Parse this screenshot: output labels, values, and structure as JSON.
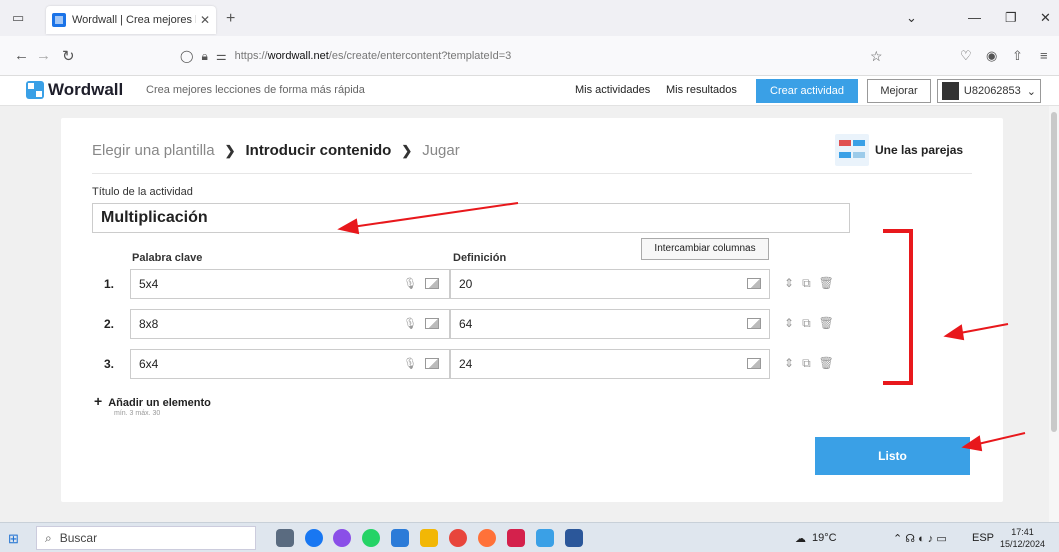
{
  "browser": {
    "tab_title": "Wordwall | Crea mejores leccion",
    "tab_close": "✕",
    "new_tab": "+",
    "url_host": "wordwall.net",
    "url_prefix": "https://",
    "url_path": "/es/create/entercontent?templateId=3"
  },
  "header": {
    "logo_text": "Wordwall",
    "tagline": "Crea mejores lecciones de forma más rápida",
    "mis_actividades": "Mis actividades",
    "mis_resultados": "Mis resultados",
    "crear_actividad": "Crear actividad",
    "mejorar": "Mejorar",
    "username": "U82062853"
  },
  "breadcrumb": {
    "step1": "Elegir una plantilla",
    "step2": "Introducir contenido",
    "step3": "Jugar"
  },
  "template": {
    "name": "Une las parejas"
  },
  "form": {
    "title_label": "Título de la actividad",
    "title_value": "Multiplicación",
    "swap_button": "Intercambiar columnas",
    "col_keyword": "Palabra clave",
    "col_definition": "Definición",
    "rows": [
      {
        "num": "1.",
        "keyword": "5x4",
        "definition": "20"
      },
      {
        "num": "2.",
        "keyword": "8x8",
        "definition": "64"
      },
      {
        "num": "3.",
        "keyword": "6x4",
        "definition": "24"
      }
    ],
    "add_item": "Añadir un elemento",
    "min_max": "mín. 3   máx. 30",
    "done_button": "Listo"
  },
  "taskbar": {
    "search_placeholder": "Buscar",
    "weather": "19°C",
    "lang": "ESP",
    "time": "17:41",
    "date": "15/12/2024"
  },
  "colors": {
    "accent": "#3aa0e6",
    "annotation": "#e8181c"
  }
}
